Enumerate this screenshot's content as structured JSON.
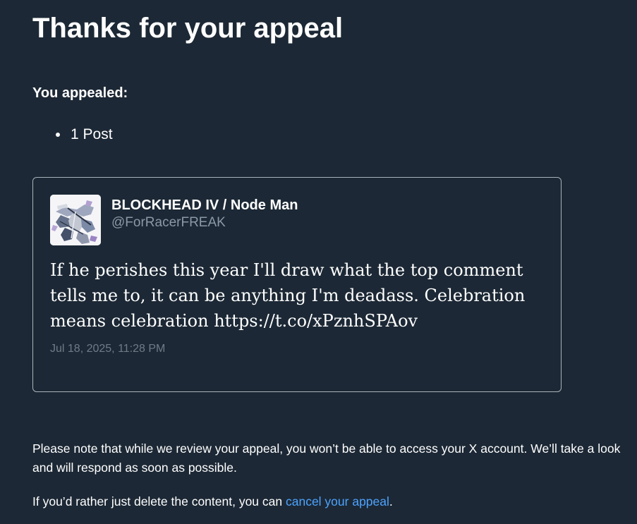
{
  "page": {
    "title": "Thanks for your appeal",
    "appealed_label": "You appealed:",
    "appealed_items": [
      "1 Post"
    ]
  },
  "post": {
    "author_name": "BLOCKHEAD IV / Node Man",
    "author_handle": "@ForRacerFREAK",
    "text": "If he perishes this year I'll draw what the top comment tells me to, it can be anything I'm deadass. Celebration means celebration https://t.co/xPznhSPAov",
    "timestamp": "Jul 18, 2025, 11:28 PM",
    "avatar_icon": "robot-mech-avatar"
  },
  "notice": {
    "review_text": "Please note that while we review your appeal, you won’t be able to access your X account. We’ll take a look and will respond as soon as possible.",
    "cancel_prefix": "If you’d rather just delete the content, you can ",
    "cancel_link": "cancel your appeal",
    "cancel_suffix": "."
  },
  "colors": {
    "background": "#1c2835",
    "text": "#ffffff",
    "muted": "#8b98a5",
    "link": "#4da3ff",
    "card_border": "#aab3bd"
  }
}
